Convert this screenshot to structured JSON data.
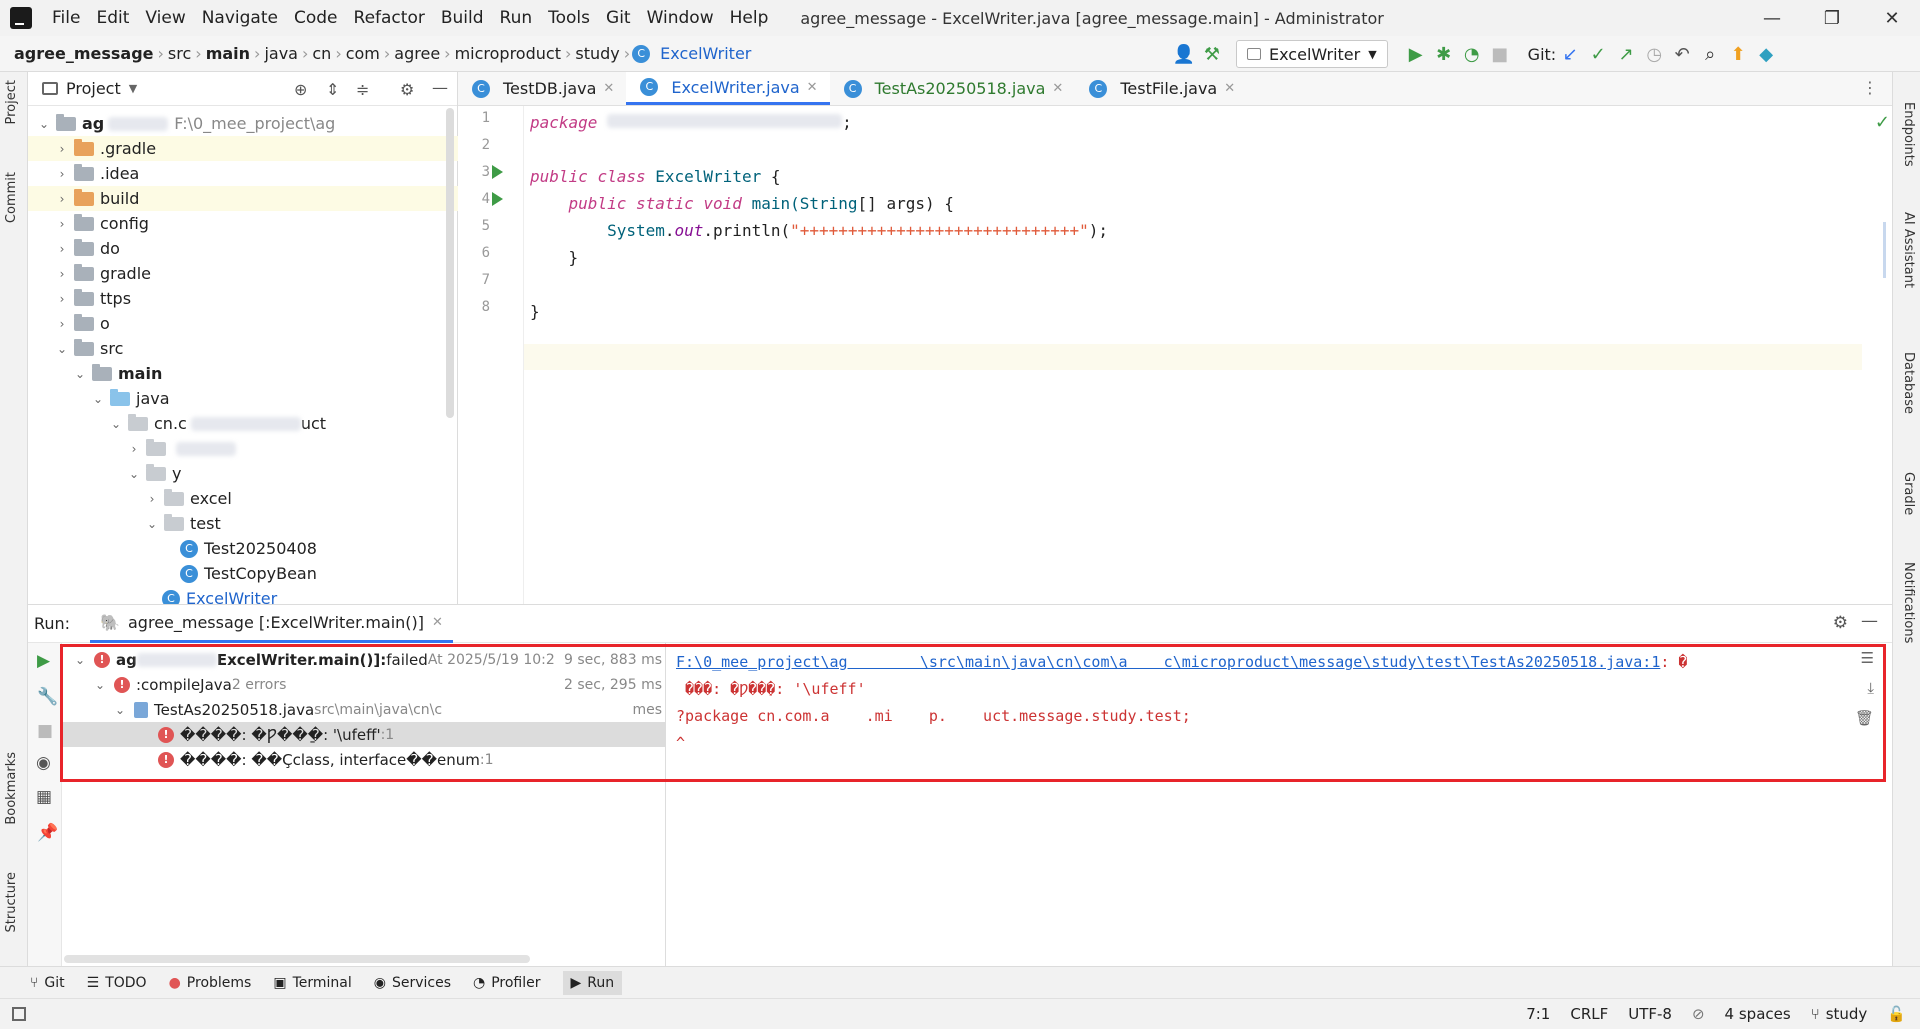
{
  "menubar": {
    "items": [
      "File",
      "Edit",
      "View",
      "Navigate",
      "Code",
      "Refactor",
      "Build",
      "Run",
      "Tools",
      "Git",
      "Window",
      "Help"
    ],
    "title": "agree_message - ExcelWriter.java [agree_message.main] - Administrator"
  },
  "breadcrumb": [
    "agree_message",
    "src",
    "main",
    "java",
    "cn",
    "com",
    "agree",
    "microproduct",
    "study",
    "ExcelWriter"
  ],
  "toolbar": {
    "run_config": "ExcelWriter",
    "git_label": "Git:"
  },
  "left_strip": {
    "project": "Project",
    "commit": "Commit",
    "bookmarks": "Bookmarks",
    "structure": "Structure"
  },
  "right_strip": {
    "endpoints": "Endpoints",
    "ai": "AI Assistant",
    "database": "Database",
    "gradle": "Gradle",
    "notifications": "Notifications"
  },
  "project": {
    "title": "Project",
    "tree": [
      {
        "label": "ag",
        "extra": "F:\\0_mee_project\\ag",
        "indent": 0,
        "arrow": "down",
        "icon": "folder-gray",
        "bold": true,
        "hl": false
      },
      {
        "label": ".gradle",
        "indent": 1,
        "arrow": "right",
        "icon": "folder-orange",
        "hl": true
      },
      {
        "label": ".idea",
        "indent": 1,
        "arrow": "right",
        "icon": "folder-gray"
      },
      {
        "label": "build",
        "indent": 1,
        "arrow": "right",
        "icon": "folder-orange",
        "hl": true
      },
      {
        "label": "config",
        "indent": 1,
        "arrow": "right",
        "icon": "folder-gray"
      },
      {
        "label": "do",
        "indent": 1,
        "arrow": "right",
        "icon": "folder-gray"
      },
      {
        "label": "gradle",
        "indent": 1,
        "arrow": "right",
        "icon": "folder-gray"
      },
      {
        "label": "ttps",
        "indent": 1,
        "arrow": "right",
        "icon": "folder-gray"
      },
      {
        "label": "o",
        "indent": 1,
        "arrow": "right",
        "icon": "folder-gray"
      },
      {
        "label": "src",
        "indent": 1,
        "arrow": "down",
        "icon": "folder-gray"
      },
      {
        "label": "main",
        "indent": 2,
        "arrow": "down",
        "icon": "folder-gray",
        "bold": true
      },
      {
        "label": "java",
        "indent": 3,
        "arrow": "down",
        "icon": "folder-blue"
      },
      {
        "label": "cn.c",
        "extra2": "uct",
        "indent": 4,
        "arrow": "down",
        "icon": "folder-pkg"
      },
      {
        "label": "",
        "indent": 5,
        "arrow": "right",
        "icon": "folder-pkg"
      },
      {
        "label": "y",
        "indent": 5,
        "arrow": "down",
        "icon": "folder-pkg"
      },
      {
        "label": "excel",
        "indent": 6,
        "arrow": "right",
        "icon": "folder-pkg"
      },
      {
        "label": "test",
        "indent": 6,
        "arrow": "down",
        "icon": "folder-pkg"
      },
      {
        "label": "Test20250408",
        "indent": 7,
        "arrow": "",
        "icon": "class"
      },
      {
        "label": "TestCopyBean",
        "indent": 7,
        "arrow": "",
        "icon": "class"
      },
      {
        "label": "ExcelWriter",
        "indent": 6,
        "arrow": "",
        "icon": "class",
        "link": true
      }
    ]
  },
  "editor": {
    "tabs": [
      {
        "label": "TestDB.java",
        "active": false
      },
      {
        "label": "ExcelWriter.java",
        "active": true
      },
      {
        "label": "TestAs20250518.java",
        "active": false,
        "color": "#2f7a2f"
      },
      {
        "label": "TestFile.java",
        "active": false
      }
    ],
    "line_numbers": [
      "1",
      "2",
      "3",
      "4",
      "5",
      "6",
      "7",
      "8"
    ],
    "code": {
      "l1_kw": "package",
      "l1_rest": ";",
      "l3_public": "public",
      "l3_class": "class",
      "l3_name": "ExcelWriter",
      "l3_brace": " {",
      "l4_public": "public",
      "l4_static": "static",
      "l4_void": "void",
      "l4_main": "main(",
      "l4_type": "String",
      "l4_rest": "[] args) {",
      "l5_system": "System",
      "l5_dot": ".",
      "l5_out": "out",
      "l5_print": ".println(",
      "l5_str": "\"+++++++++++++++++++++++++++++\"",
      "l5_end": ");",
      "l6": "}",
      "l8": "}"
    }
  },
  "run": {
    "label": "Run:",
    "tab": "agree_message [:ExcelWriter.main()]",
    "tree": [
      {
        "prefix": "ag",
        "main": "ExcelWriter.main()]:",
        "status": " failed",
        "meta": " At 2025/5/19 10:2",
        "time": "9 sec, 883 ms",
        "indent": 0,
        "arrow": "down"
      },
      {
        "prefix": "",
        "main": ":compileJava",
        "status": "",
        "meta": " 2 errors",
        "time": "2 sec, 295 ms",
        "indent": 1,
        "arrow": "down"
      },
      {
        "prefix": "",
        "main": "TestAs20250518.java",
        "status": "",
        "meta": " src\\main\\java\\cn\\c",
        "time": "mes",
        "indent": 2,
        "arrow": "down",
        "fileicon": true
      },
      {
        "prefix": "",
        "main": "����: �Ƿ��ַ�: '\\ufeff'",
        "status": "",
        "meta": " :1",
        "time": "",
        "indent": 4,
        "arrow": "",
        "selected": true
      },
      {
        "prefix": "",
        "main": "����: ��Ҫclass, interface��enum",
        "status": "",
        "meta": " :1",
        "time": "",
        "indent": 4,
        "arrow": ""
      }
    ],
    "console": {
      "link": "F:\\0_mee_project\\ag        \\src\\main\\java\\cn\\com\\a    c\\microproduct\\message\\study\\test\\TestAs20250518.java:1",
      "link_tail": ": �",
      "line2": " ���: �Ƿ��ַ�: '\\ufeff'",
      "line3": "?package cn.com.a    .mi    p.    uct.message.study.test;",
      "line4": "^"
    }
  },
  "bottom_tabs": [
    "Git",
    "TODO",
    "Problems",
    "Terminal",
    "Services",
    "Profiler",
    "Run"
  ],
  "status": {
    "pos": "7:1",
    "eol": "CRLF",
    "enc": "UTF-8",
    "indent": "4 spaces",
    "branch": "study"
  }
}
